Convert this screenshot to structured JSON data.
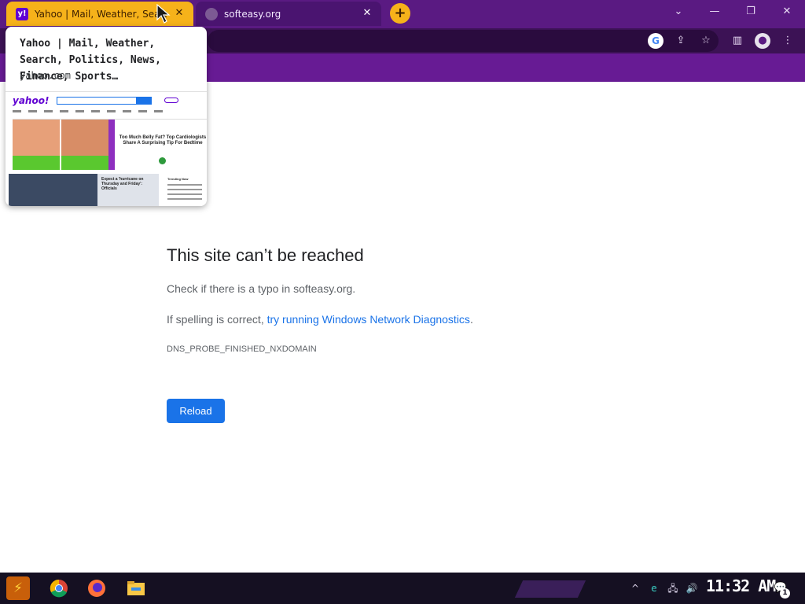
{
  "tabs": [
    {
      "title": "Yahoo | Mail, Weather, Search, Politics, News, Finance, Sports…",
      "favicon": "yahoo-icon",
      "close": "✕"
    },
    {
      "title": "softeasy.org",
      "favicon": "globe-icon",
      "close": "✕"
    }
  ],
  "newtab_label": "+",
  "window_controls": {
    "tablist": "⌄",
    "minimize": "—",
    "maximize": "❐",
    "close": "✕"
  },
  "toolbar": {
    "google_icon": "G",
    "share_icon": "⇪",
    "bookmark_icon": "☆",
    "sidepanel_icon": "▥",
    "profile_icon": "●",
    "menu_icon": "⋮"
  },
  "hovercard": {
    "title": "Yahoo | Mail, Weather, Search, Politics, News, Finance, Sports…",
    "domain": "yahoo.com",
    "thumb": {
      "logo": "yahoo!",
      "ad_text": "Too Much Belly Fat? Top Cardiologists Share A Surprising Tip For Bedtime",
      "news_text": "Expect a 'hurricane on Thursday and Friday': Officials",
      "trending_title": "Trending Now"
    }
  },
  "error_page": {
    "title": "This site can’t be reached",
    "line1": "Check if there is a typo in softeasy.org.",
    "line2_prefix": "If spelling is correct, ",
    "line2_link": "try running Windows Network Diagnostics",
    "line2_suffix": ".",
    "code": "DNS_PROBE_FINISHED_NXDOMAIN",
    "reload_label": "Reload"
  },
  "taskbar": {
    "clock": "11:32 AM",
    "notification_count": "1",
    "tray": {
      "chevron": "^",
      "edge": "e",
      "network": "🖧",
      "volume": "🔊",
      "notifications": "💬"
    }
  },
  "colors": {
    "tab_active": "#f6b21a",
    "tabstrip": "#5a1a82",
    "toolbar": "#3c1255",
    "accent": "#1a73e8"
  }
}
